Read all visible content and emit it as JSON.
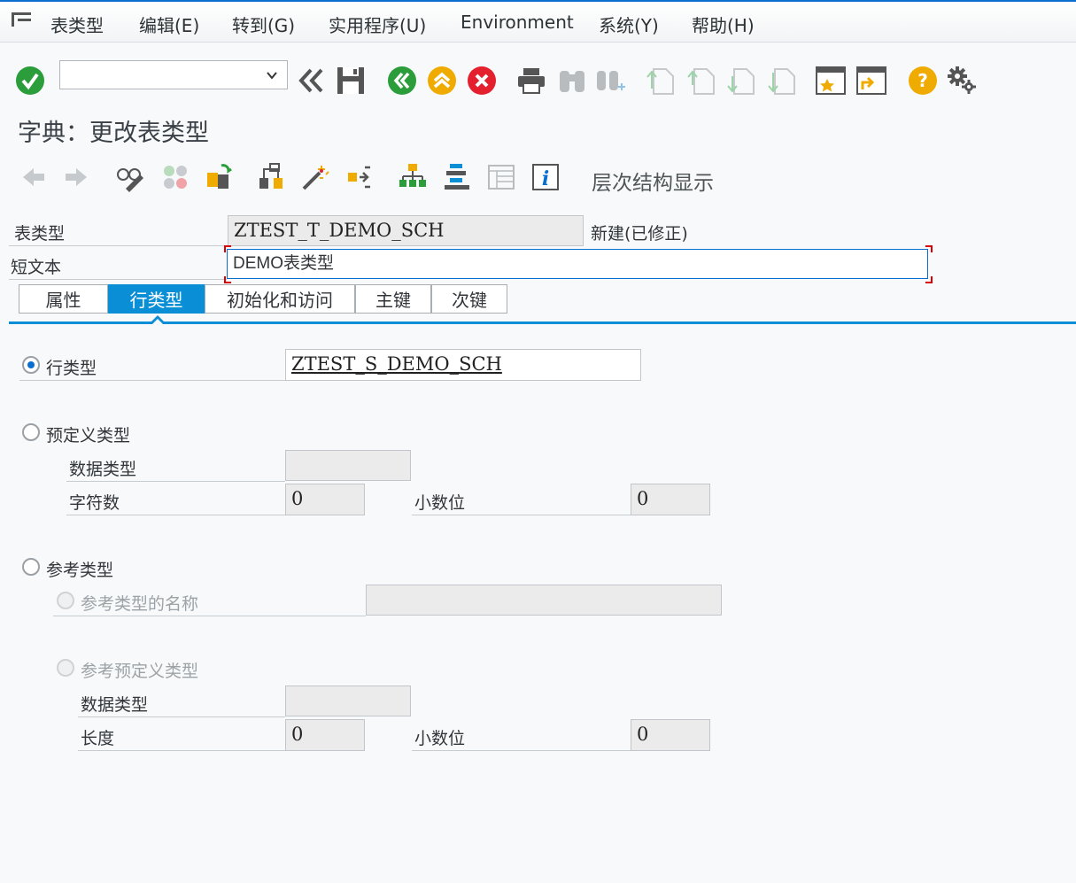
{
  "menubar": {
    "items": [
      "表类型",
      "编辑(E)",
      "转到(G)",
      "实用程序(U)",
      "Environment",
      "系统(Y)",
      "帮助(H)"
    ]
  },
  "toolbar": {
    "command_value": "",
    "icons": [
      "enter-icon",
      "command-dropdown-icon",
      "back-double-icon",
      "save-icon",
      "green-back-icon",
      "exit-icon",
      "cancel-icon",
      "print-icon",
      "find-icon",
      "find-next-icon",
      "first-page-icon",
      "previous-page-icon",
      "next-page-icon",
      "last-page-icon",
      "create-session-icon",
      "shortcut-icon",
      "help-icon",
      "settings-icon"
    ]
  },
  "title": "字典：更改表类型",
  "app_toolbar": {
    "hierarchy_label": "层次结构显示"
  },
  "header": {
    "table_type_label": "表类型",
    "table_type_value": "ZTEST_T_DEMO_SCH",
    "status": "新建(已修正)",
    "short_text_label": "短文本",
    "short_text_value": "DEMO表类型"
  },
  "tabs": [
    "属性",
    "行类型",
    "初始化和访问",
    "主键",
    "次键"
  ],
  "active_tab": "行类型",
  "row_type": {
    "label": "行类型",
    "value": "ZTEST_S_DEMO_SCH",
    "selected": true
  },
  "predefined": {
    "label": "预定义类型",
    "data_type_label": "数据类型",
    "data_type_value": "",
    "chars_label": "字符数",
    "chars_value": "0",
    "decimals_label": "小数位",
    "decimals_value": "0"
  },
  "ref_type": {
    "label": "参考类型",
    "name_label": "参考类型的名称",
    "name_value": "",
    "predef_label": "参考预定义类型",
    "data_type_label": "数据类型",
    "data_type_value": "",
    "length_label": "长度",
    "length_value": "0",
    "decimals_label": "小数位",
    "decimals_value": "0"
  },
  "colors": {
    "accent": "#0a8fd6",
    "enter_green": "#2b9d3a",
    "exit_orange": "#f0ab00",
    "cancel_red": "#e5202e"
  }
}
